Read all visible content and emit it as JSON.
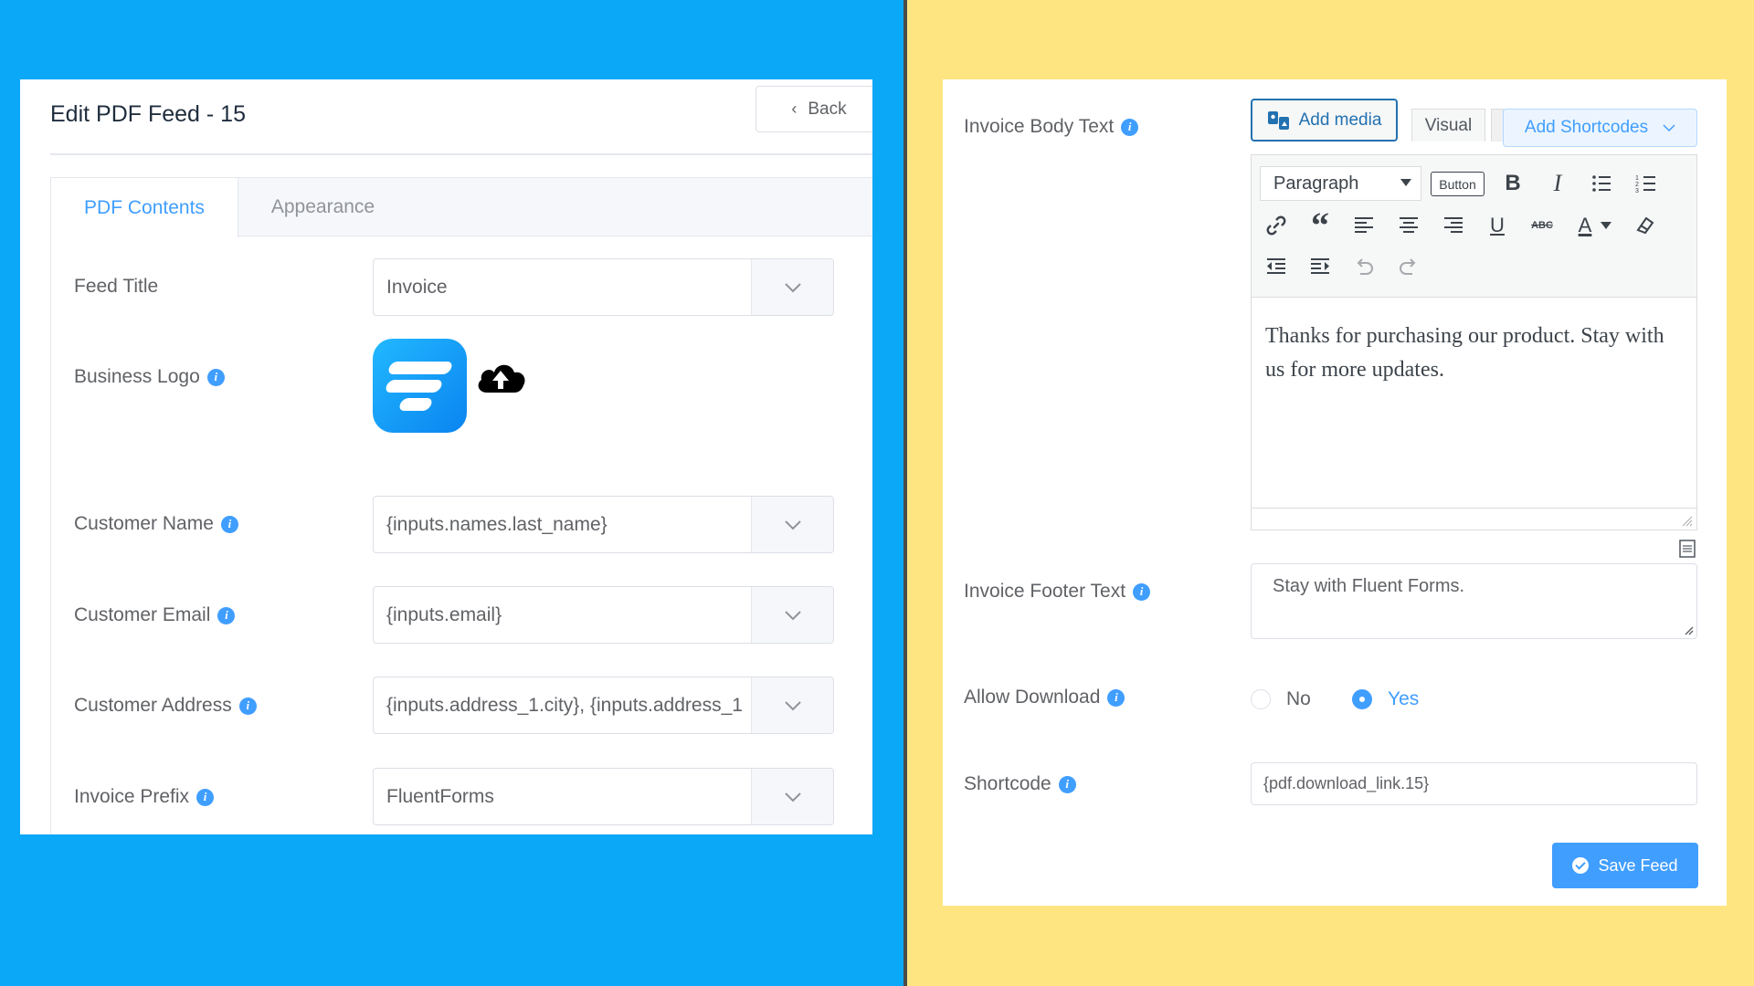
{
  "left": {
    "title": "Edit PDF Feed - 15",
    "back_label": "Back",
    "tabs": [
      {
        "label": "PDF Contents",
        "active": true
      },
      {
        "label": "Appearance",
        "active": false
      }
    ],
    "fields": {
      "feed_title": {
        "label": "Feed Title",
        "value": "Invoice"
      },
      "business_logo": {
        "label": "Business Logo"
      },
      "customer_name": {
        "label": "Customer Name",
        "value": "{inputs.names.last_name}"
      },
      "customer_email": {
        "label": "Customer Email",
        "value": "{inputs.email}"
      },
      "customer_address": {
        "label": "Customer Address",
        "value": "{inputs.address_1.city}, {inputs.address_1"
      },
      "invoice_prefix": {
        "label": "Invoice Prefix",
        "value": "FluentForms"
      }
    }
  },
  "right": {
    "invoice_body": {
      "label": "Invoice Body Text",
      "add_media": "Add media",
      "tab_visual": "Visual",
      "add_shortcodes": "Add Shortcodes",
      "format_select": "Paragraph",
      "button_label": "Button",
      "body": "Thanks for purchasing our product. Stay with us for more updates."
    },
    "invoice_footer": {
      "label": "Invoice Footer Text",
      "value": "Stay with Fluent Forms."
    },
    "allow_download": {
      "label": "Allow Download",
      "options": [
        {
          "label": "No",
          "checked": false
        },
        {
          "label": "Yes",
          "checked": true
        }
      ]
    },
    "shortcode": {
      "label": "Shortcode",
      "value": "{pdf.download_link.15}"
    },
    "save_label": "Save Feed"
  },
  "colors": {
    "left_bg": "#0aa8f7",
    "right_bg": "#fee582",
    "primary": "#409eff",
    "wp_blue": "#2271b1"
  }
}
